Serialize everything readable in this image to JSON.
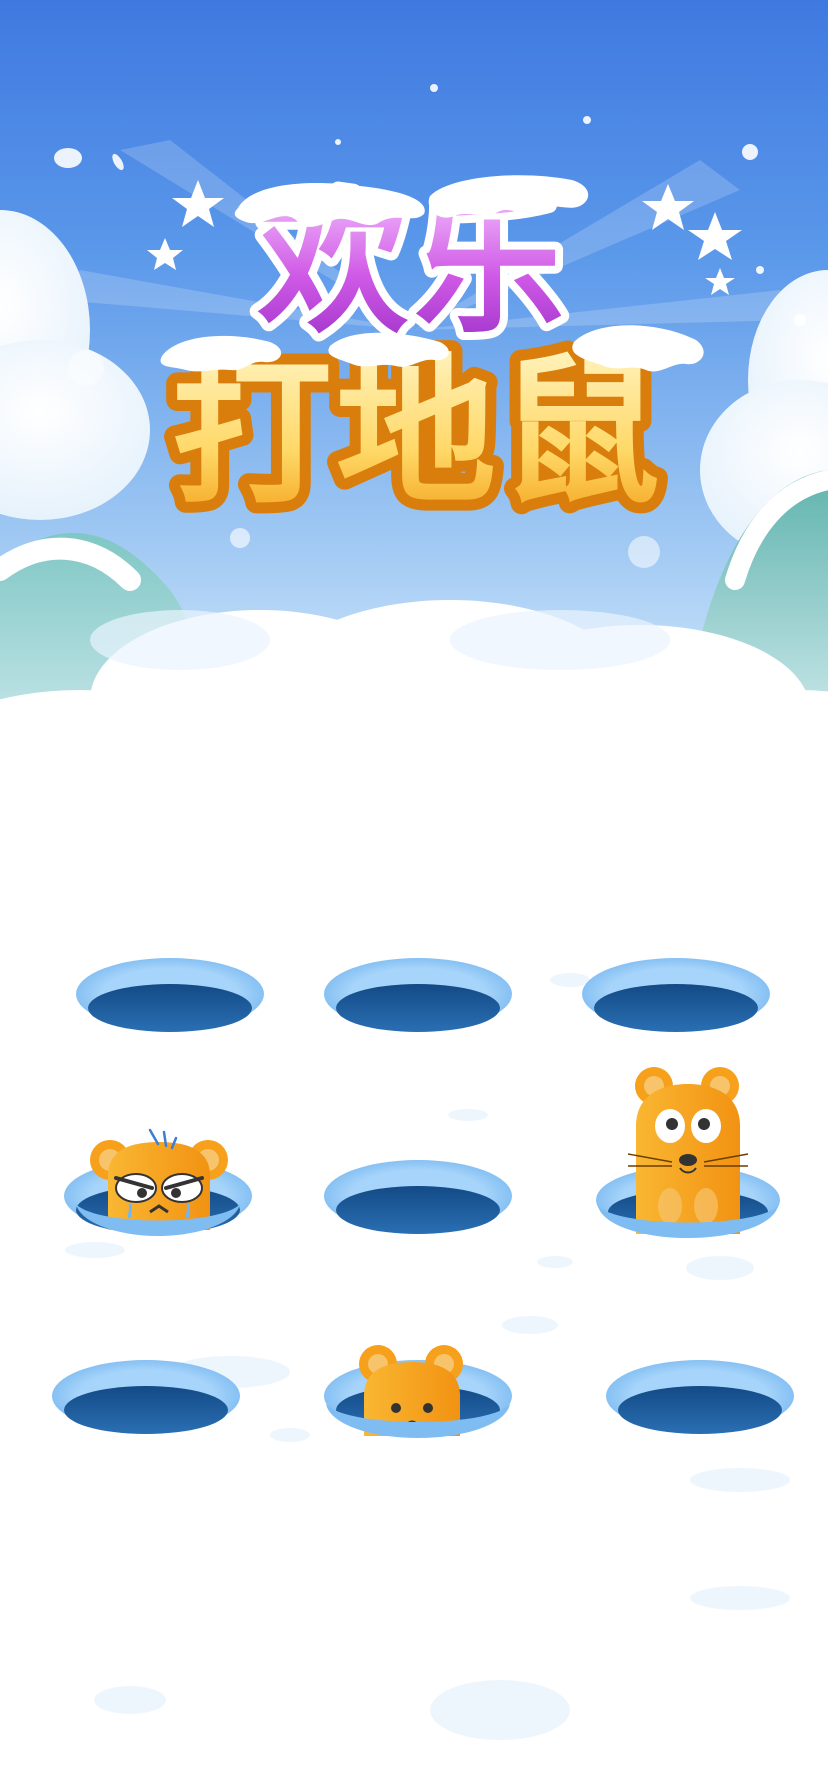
{
  "game": {
    "title_line1": "欢乐",
    "title_line2": "打地鼠"
  },
  "colors": {
    "sky_top": "#3f79e0",
    "title_purple": "#b63ad8",
    "title_orange": "#f6a623",
    "hole_rim": "#8cc4f5",
    "hole_inner": "#1f5fa0",
    "mole_body": "#f7a51e",
    "snow": "#ffffff"
  },
  "board": {
    "rows": 3,
    "cols": 3,
    "holes": [
      {
        "row": 1,
        "col": 1,
        "state": "empty"
      },
      {
        "row": 1,
        "col": 2,
        "state": "empty"
      },
      {
        "row": 1,
        "col": 3,
        "state": "empty"
      },
      {
        "row": 2,
        "col": 1,
        "state": "mole-hit"
      },
      {
        "row": 2,
        "col": 2,
        "state": "empty"
      },
      {
        "row": 2,
        "col": 3,
        "state": "mole-up"
      },
      {
        "row": 3,
        "col": 1,
        "state": "empty"
      },
      {
        "row": 3,
        "col": 2,
        "state": "mole-peek"
      },
      {
        "row": 3,
        "col": 3,
        "state": "empty"
      }
    ]
  }
}
